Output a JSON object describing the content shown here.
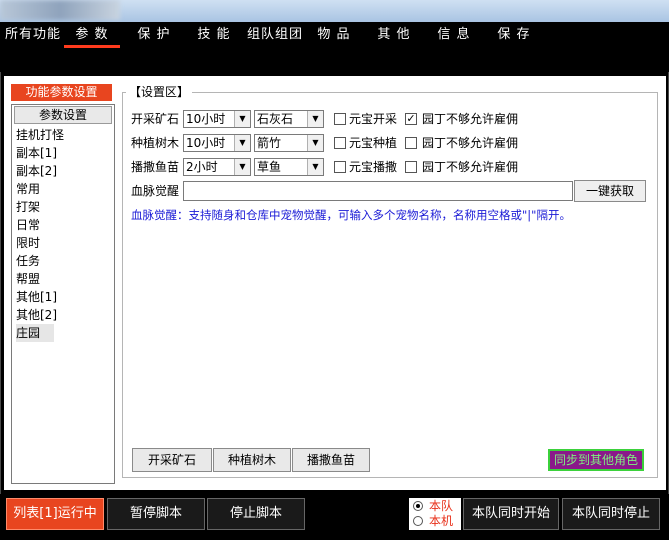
{
  "nav": {
    "tabs": [
      {
        "label": "所有功能"
      },
      {
        "label": "参 数"
      },
      {
        "label": "保 护"
      },
      {
        "label": "技 能"
      },
      {
        "label": "组队组团"
      },
      {
        "label": "物 品"
      },
      {
        "label": "其 他"
      },
      {
        "label": "信 息"
      },
      {
        "label": "保 存"
      }
    ],
    "active_tab": "参 数"
  },
  "sidebar": {
    "header": "功能参数设置",
    "param_button": "参数设置",
    "items": [
      {
        "label": "挂机打怪"
      },
      {
        "label": "副本[1]"
      },
      {
        "label": "副本[2]"
      },
      {
        "label": "常用"
      },
      {
        "label": "打架"
      },
      {
        "label": "日常"
      },
      {
        "label": "限时"
      },
      {
        "label": "任务"
      },
      {
        "label": "帮盟"
      },
      {
        "label": "其他[1]"
      },
      {
        "label": "其他[2]"
      },
      {
        "label": "庄园"
      }
    ],
    "selected": "庄园"
  },
  "settings": {
    "title": "【设置区】",
    "rows": [
      {
        "label": "开采矿石",
        "time": "10小时",
        "item": "石灰石",
        "yuanbao_label": "元宝开采",
        "yuanbao_checked": false,
        "gardener_label": "园丁不够允许雇佣",
        "gardener_checked": true
      },
      {
        "label": "种植树木",
        "time": "10小时",
        "item": "箭竹",
        "yuanbao_label": "元宝种植",
        "yuanbao_checked": false,
        "gardener_label": "园丁不够允许雇佣",
        "gardener_checked": false
      },
      {
        "label": "播撒鱼苗",
        "time": "2小时",
        "item": "草鱼",
        "yuanbao_label": "元宝播撒",
        "yuanbao_checked": false,
        "gardener_label": "园丁不够允许雇佣",
        "gardener_checked": false
      }
    ],
    "blood_label": "血脉觉醒",
    "blood_value": "",
    "one_click_button": "一键获取",
    "blood_note": "血脉觉醒：支持随身和仓库中宠物觉醒，可输入多个宠物名称，名称用空格或\"|\"隔开。",
    "action_buttons": [
      {
        "label": "开采矿石"
      },
      {
        "label": "种植树木"
      },
      {
        "label": "播撒鱼苗"
      }
    ],
    "sync_button": "同步到其他角色"
  },
  "bottom": {
    "running": "列表[1]运行中",
    "pause": "暂停脚本",
    "stop": "停止脚本",
    "radio_team": "本队",
    "radio_machine": "本机",
    "radio_selected": "本队",
    "start_all": "本队同时开始",
    "stop_all": "本队同时停止"
  },
  "colors": {
    "accent_red": "#e8451f",
    "note_blue": "#1a1ad6",
    "sync_purple": "#8a188a",
    "sync_green": "#3bd13b"
  }
}
